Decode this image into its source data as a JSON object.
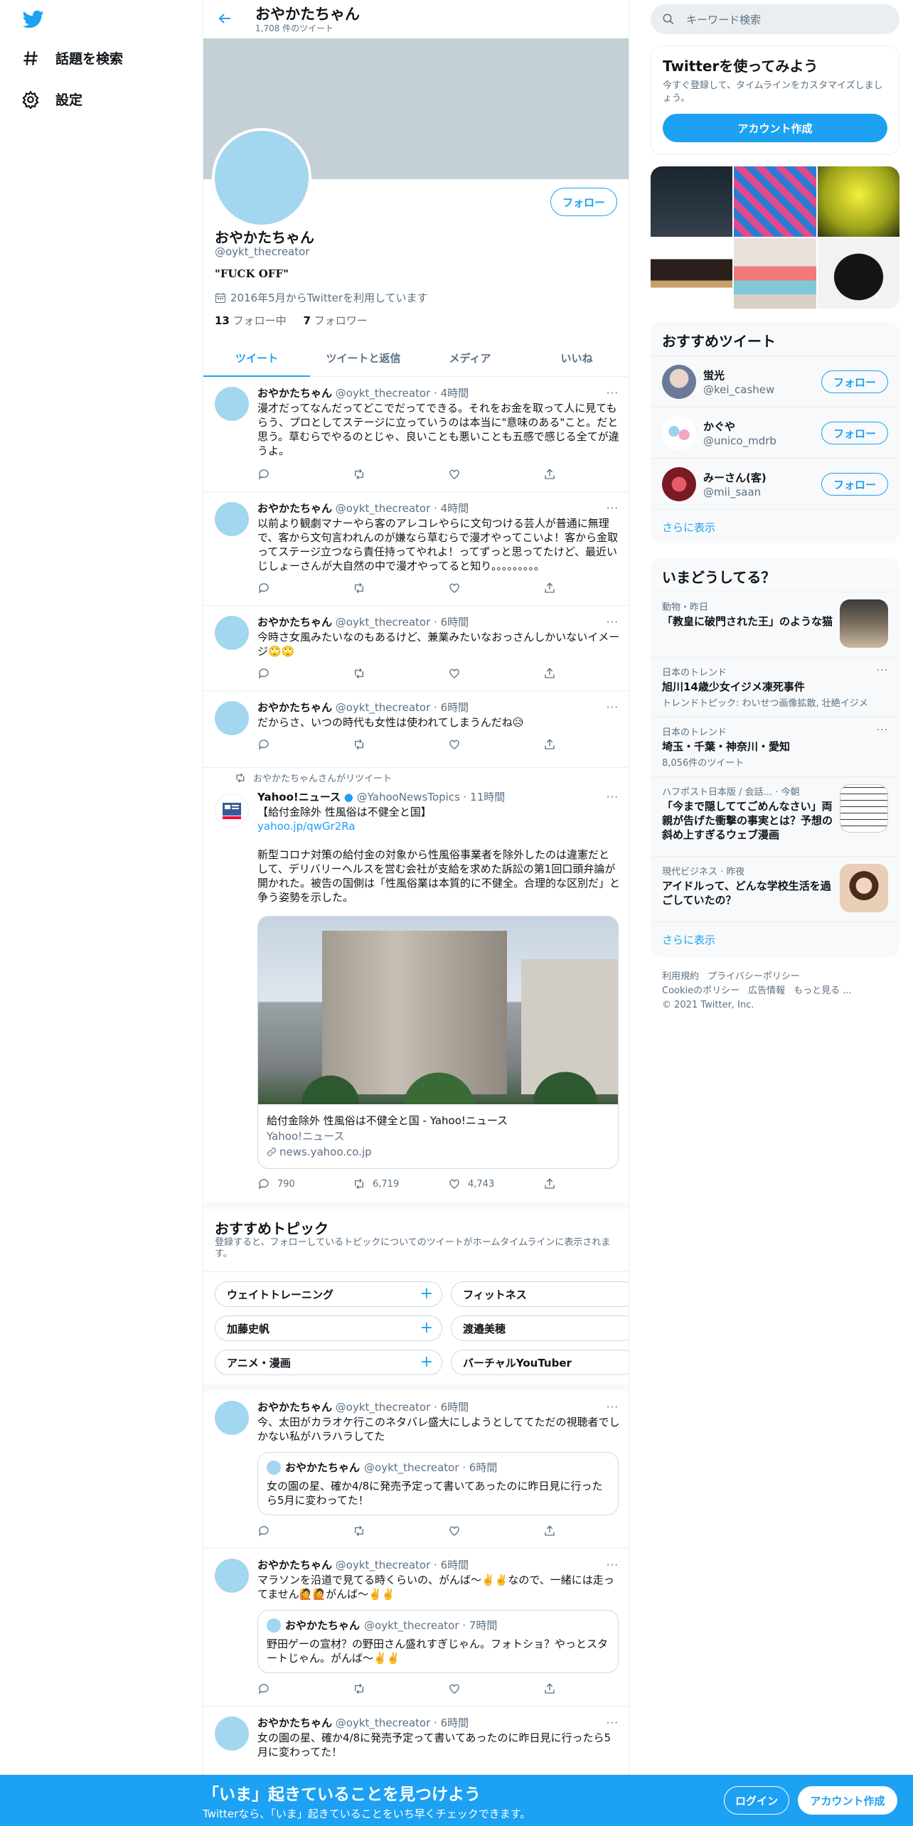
{
  "nav": {
    "explore_label": "話題を検索",
    "settings_label": "設定"
  },
  "profile": {
    "name": "おやかたちゃん",
    "tweet_count": "1,708 件のツイート",
    "handle": "@oykt_thecreator",
    "bio": "\"FUCK OFF\"",
    "joined": "2016年5月からTwitterを利用しています",
    "following_count": "13",
    "following_label": "フォロー中",
    "followers_count": "7",
    "followers_label": "フォロワー",
    "follow_label": "フォロー"
  },
  "tabs": [
    "ツイート",
    "ツイートと返信",
    "メディア",
    "いいね"
  ],
  "tweets": [
    {
      "name": "おやかたちゃん",
      "meta": "@oykt_thecreator · 4時間",
      "text": "漫才だってなんだってどこでだってできる。それをお金を取って人に見てもらう、プロとしてステージに立っていうのは本当に\"意味のある\"こと。だと思う。草むらでやるのとじゃ、良いことも悪いことも五感で感じる全てが違うよ。"
    },
    {
      "name": "おやかたちゃん",
      "meta": "@oykt_thecreator · 4時間",
      "text": "以前より観劇マナーやら客のアレコレやらに文句つける芸人が普通に無理で、客から文句言われんのが嫌なら草むらで漫才やってこいよ！客から金取ってステージ立つなら責任持ってやれよ！ってずっと思ってたけど、最近いじしょーさんが大自然の中で漫才やってると知り。。。。。。。。。"
    },
    {
      "name": "おやかたちゃん",
      "meta": "@oykt_thecreator · 6時間",
      "text": "今時さ女風みたいなのもあるけど、兼業みたいなおっさんしかいないイメージ🙄🙄"
    },
    {
      "name": "おやかたちゃん",
      "meta": "@oykt_thecreator · 6時間",
      "text": "だからさ、いつの時代も女性は使われてしまうんだね😥"
    }
  ],
  "retweet": {
    "label": "おやかたちゃんさんがリツイート",
    "name": "Yahoo!ニュース",
    "meta": "@YahooNewsTopics · 11時間",
    "line1": "【給付金除外 性風俗は不健全と国】",
    "link": "yahoo.jp/qwGr2Ra",
    "text": "新型コロナ対策の給付金の対象から性風俗事業者を除外したのは違憲だとして、デリバリーヘルスを営む会社が支給を求めた訴訟の第1回口頭弁論が開かれた。被告の国側は「性風俗業は本質的に不健全。合理的な区別だ」と争う姿勢を示した。",
    "card_title": "給付金除外 性風俗は不健全と国 - Yahoo!ニュース",
    "card_source": "Yahoo!ニュース",
    "card_domain": "news.yahoo.co.jp",
    "replies": "790",
    "retweets": "6,719",
    "likes": "4,743"
  },
  "topics": {
    "title": "おすすめトピック",
    "subtitle": "登録すると、フォローしているトピックについてのツイートがホームタイムラインに表示されます。",
    "chips": [
      "ウェイトトレーニング",
      "フィットネス",
      "加藤史帆",
      "渡邉美穂",
      "アニメ・漫画",
      "バーチャルYouTuber"
    ]
  },
  "tweets2": [
    {
      "name": "おやかたちゃん",
      "meta": "@oykt_thecreator · 6時間",
      "text": "今、太田がカラオケ行このネタバレ盛大にしようとしててただの視聴者でしかない私がハラハラしてた",
      "q_name": "おやかたちゃん",
      "q_meta": "@oykt_thecreator · 6時間",
      "q_text": "女の園の星、確か4/8に発売予定って書いてあったのに昨日見に行ったら5月に変わってた！"
    },
    {
      "name": "おやかたちゃん",
      "meta": "@oykt_thecreator · 6時間",
      "text": "マラソンを沿道で見てる時くらいの、がんば〜✌️✌️なので、一緒には走ってません🙋🙋がんば〜✌️✌️",
      "q_name": "おやかたちゃん",
      "q_meta": "@oykt_thecreator · 7時間",
      "q_text": "野田ゲーの宣材？の野田さん盛れすぎじゃん。フォトショ？やっとスタートじゃん。がんば〜✌️✌️"
    },
    {
      "name": "おやかたちゃん",
      "meta": "@oykt_thecreator · 6時間",
      "text": "女の園の星、確か4/8に発売予定って書いてあったのに昨日見に行ったら5月に変わってた！"
    }
  ],
  "right": {
    "search_placeholder": "キーワード検索",
    "join_title": "Twitterを使ってみよう",
    "join_sub": "今すぐ登録して、タイムラインをカスタマイズしましょう。",
    "create_account": "アカウント作成",
    "rec_title": "おすすめツイート",
    "suggestions": [
      {
        "name": "蛍光",
        "handle": "@kei_cashew",
        "btn": "フォロー"
      },
      {
        "name": "かぐや",
        "handle": "@unico_mdrb",
        "btn": "フォロー"
      },
      {
        "name": "みーさん(客)",
        "handle": "@mii_saan",
        "btn": "フォロー"
      }
    ],
    "show_more": "さらに表示",
    "trends_title": "いまどうしてる？",
    "trends": [
      {
        "ctx": "動物・昨日",
        "title": "「教皇に破門された王」のような猫",
        "sub": ""
      },
      {
        "ctx": "日本のトレンド",
        "title": "旭川14歳少女イジメ凍死事件",
        "sub": "トレンドトピック: わいせつ画像拡散, 壮絶イジメ"
      },
      {
        "ctx": "日本のトレンド",
        "title": "埼玉・千葉・神奈川・愛知",
        "sub": "8,056件のツイート"
      },
      {
        "ctx": "ハフポスト日本版 / 会話... · 今朝",
        "title": "「今まで隠しててごめんなさい」両親が告げた衝撃の事実とは？予想の斜め上すぎるウェブ漫画",
        "sub": ""
      },
      {
        "ctx": "現代ビジネス · 昨夜",
        "title": "アイドルって、どんな学校生活を過ごしていたの？",
        "sub": ""
      }
    ],
    "footer_links": [
      "利用規約",
      "プライバシーポリシー",
      "Cookieのポリシー",
      "広告情報",
      "もっと見る ..."
    ],
    "copyright": "© 2021 Twitter, Inc."
  },
  "bottom": {
    "title": "「いま」起きていることを見つけよう",
    "sub": "Twitterなら、「いま」起きていることをいち早くチェックできます。",
    "login": "ログイン",
    "signup": "アカウント作成"
  },
  "colors": {
    "accent": "#1da1f2",
    "banner": "#c4cfd6",
    "avatar": "#a3d6ef"
  }
}
